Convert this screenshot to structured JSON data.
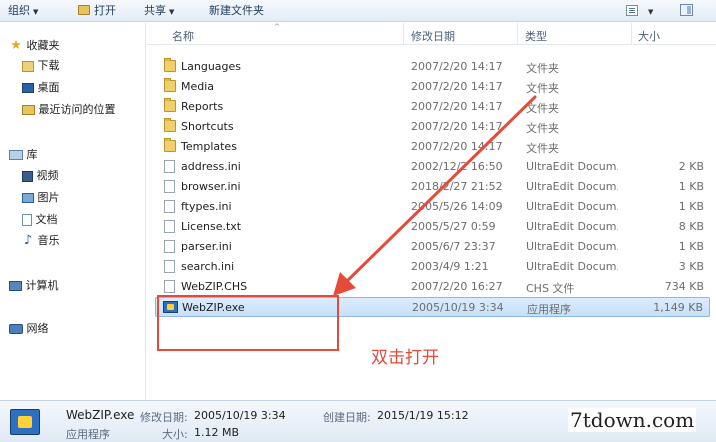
{
  "toolbar": {
    "organize": "组织",
    "open": "打开",
    "share": "共享",
    "new_folder": "新建文件夹"
  },
  "nav": {
    "favorites": "收藏夹",
    "downloads": "下载",
    "desktop": "桌面",
    "recent": "最近访问的位置",
    "libraries": "库",
    "videos": "视频",
    "pictures": "图片",
    "documents": "文档",
    "music": "音乐",
    "computer": "计算机",
    "network": "网络"
  },
  "columns": {
    "name": "名称",
    "date": "修改日期",
    "type": "类型",
    "size": "大小"
  },
  "files": [
    {
      "name": "Languages",
      "date": "2007/2/20 14:17",
      "type": "文件夹",
      "size": "",
      "icon": "folder-icon"
    },
    {
      "name": "Media",
      "date": "2007/2/20 14:17",
      "type": "文件夹",
      "size": "",
      "icon": "folder-icon"
    },
    {
      "name": "Reports",
      "date": "2007/2/20 14:17",
      "type": "文件夹",
      "size": "",
      "icon": "folder-icon"
    },
    {
      "name": "Shortcuts",
      "date": "2007/2/20 14:17",
      "type": "文件夹",
      "size": "",
      "icon": "folder-icon"
    },
    {
      "name": "Templates",
      "date": "2007/2/20 14:17",
      "type": "文件夹",
      "size": "",
      "icon": "folder-icon"
    },
    {
      "name": "address.ini",
      "date": "2002/12/2 16:50",
      "type": "UltraEdit Docum...",
      "size": "2 KB",
      "icon": "file-icon"
    },
    {
      "name": "browser.ini",
      "date": "2018/2/27 21:52",
      "type": "UltraEdit Docum...",
      "size": "1 KB",
      "icon": "file-icon"
    },
    {
      "name": "ftypes.ini",
      "date": "2005/5/26 14:09",
      "type": "UltraEdit Docum...",
      "size": "1 KB",
      "icon": "file-icon"
    },
    {
      "name": "License.txt",
      "date": "2005/5/27 0:59",
      "type": "UltraEdit Docum...",
      "size": "8 KB",
      "icon": "file-icon"
    },
    {
      "name": "parser.ini",
      "date": "2005/6/7 23:37",
      "type": "UltraEdit Docum...",
      "size": "1 KB",
      "icon": "file-icon"
    },
    {
      "name": "search.ini",
      "date": "2003/4/9 1:21",
      "type": "UltraEdit Docum...",
      "size": "3 KB",
      "icon": "file-icon"
    },
    {
      "name": "WebZIP.CHS",
      "date": "2007/2/20 16:27",
      "type": "CHS 文件",
      "size": "734 KB",
      "icon": "file-icon"
    },
    {
      "name": "WebZIP.exe",
      "date": "2005/10/19 3:34",
      "type": "应用程序",
      "size": "1,149 KB",
      "icon": "exe-icon"
    }
  ],
  "annotation": "双击打开",
  "details": {
    "name": "WebZIP.exe",
    "modified_label": "修改日期:",
    "modified": "2005/10/19 3:34",
    "created_label": "创建日期:",
    "created": "2015/1/19 15:12",
    "type": "应用程序",
    "size_label": "大小:",
    "size": "1.12 MB"
  },
  "watermark": "7tdown.com",
  "colors": {
    "annotation": "#e64a3b",
    "selection": "#cce4fb",
    "toolbar": "#e3ecf6"
  }
}
